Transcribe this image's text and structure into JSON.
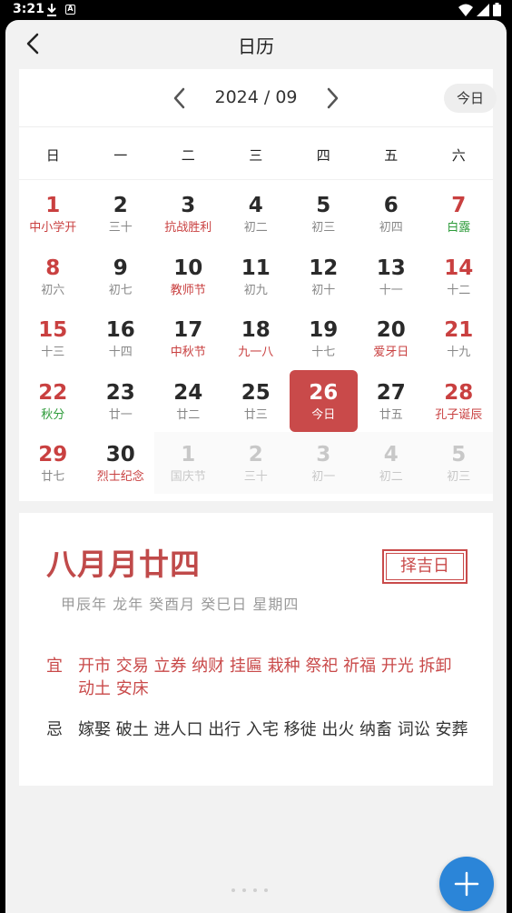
{
  "status_bar": {
    "time": "3:21",
    "a_icon": "A"
  },
  "header": {
    "title": "日历"
  },
  "calendar": {
    "month_label": "2024 / 09",
    "today_label": "今日",
    "weekdays": [
      "日",
      "一",
      "二",
      "三",
      "四",
      "五",
      "六"
    ],
    "days": [
      {
        "day": "1",
        "lunar": "中小学开"
      },
      {
        "day": "2",
        "lunar": "三十"
      },
      {
        "day": "3",
        "lunar": "抗战胜利"
      },
      {
        "day": "4",
        "lunar": "初二"
      },
      {
        "day": "5",
        "lunar": "初三"
      },
      {
        "day": "6",
        "lunar": "初四"
      },
      {
        "day": "7",
        "lunar": "白露"
      },
      {
        "day": "8",
        "lunar": "初六"
      },
      {
        "day": "9",
        "lunar": "初七"
      },
      {
        "day": "10",
        "lunar": "教师节"
      },
      {
        "day": "11",
        "lunar": "初九"
      },
      {
        "day": "12",
        "lunar": "初十"
      },
      {
        "day": "13",
        "lunar": "十一"
      },
      {
        "day": "14",
        "lunar": "十二"
      },
      {
        "day": "15",
        "lunar": "十三"
      },
      {
        "day": "16",
        "lunar": "十四"
      },
      {
        "day": "17",
        "lunar": "中秋节"
      },
      {
        "day": "18",
        "lunar": "九一八"
      },
      {
        "day": "19",
        "lunar": "十七"
      },
      {
        "day": "20",
        "lunar": "爱牙日"
      },
      {
        "day": "21",
        "lunar": "十九"
      },
      {
        "day": "22",
        "lunar": "秋分"
      },
      {
        "day": "23",
        "lunar": "廿一"
      },
      {
        "day": "24",
        "lunar": "廿二"
      },
      {
        "day": "25",
        "lunar": "廿三"
      },
      {
        "day": "26",
        "lunar": "今日"
      },
      {
        "day": "27",
        "lunar": "廿五"
      },
      {
        "day": "28",
        "lunar": "孔子诞辰"
      },
      {
        "day": "29",
        "lunar": "廿七"
      },
      {
        "day": "30",
        "lunar": "烈士纪念"
      },
      {
        "day": "1",
        "lunar": "国庆节"
      },
      {
        "day": "2",
        "lunar": "三十"
      },
      {
        "day": "3",
        "lunar": "初一"
      },
      {
        "day": "4",
        "lunar": "初二"
      },
      {
        "day": "5",
        "lunar": "初三"
      }
    ],
    "red_lunar_indices": [
      0,
      2,
      9,
      16,
      17,
      19,
      27,
      29
    ],
    "green_lunar_indices": [
      6,
      21
    ],
    "selected_index": 25,
    "other_month_start_index": 30
  },
  "detail": {
    "lunar_date": "八月月廿四",
    "zeji_label": "择吉日",
    "ganzhi": "甲辰年 龙年 癸酉月 癸巳日 星期四",
    "yi_label": "宜",
    "yi_items": "开市 交易 立券 纳财 挂匾 栽种 祭祀 祈福 开光 拆卸 动土 安床",
    "ji_label": "忌",
    "ji_items": "嫁娶 破土 进人口 出行 入宅 移徙 出火 纳畜 词讼 安葬"
  },
  "colors": {
    "accent_red": "#c94a4a",
    "fab_blue": "#2b85d8",
    "holiday_green": "#2e9b3a"
  },
  "icons": [
    "back-arrow-icon",
    "chevron-left-icon",
    "chevron-right-icon",
    "plus-icon",
    "download-icon",
    "wifi-icon",
    "battery-icon"
  ]
}
